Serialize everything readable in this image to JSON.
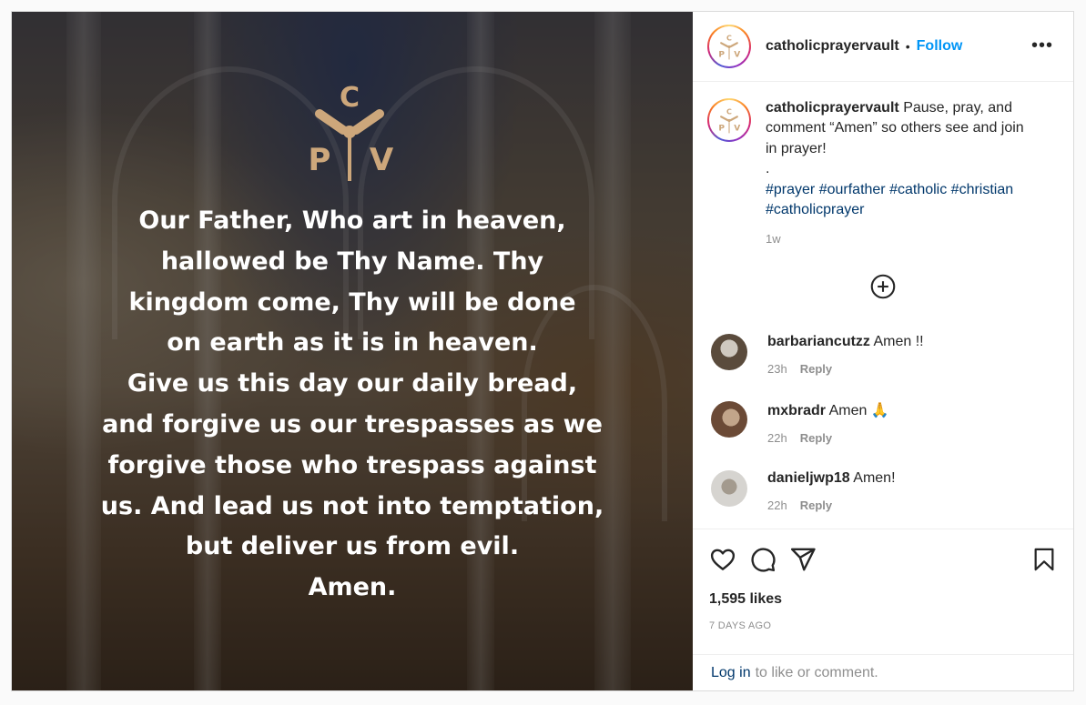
{
  "post": {
    "username": "catholicprayervault",
    "follow_label": "Follow",
    "more_label": "•••",
    "logo_letters": [
      "C",
      "P",
      "V"
    ],
    "image_text": [
      "Our Father, Who art in heaven,",
      "hallowed be Thy Name. Thy",
      "kingdom come, Thy will be done",
      "on earth as it is in heaven.",
      "Give us this day our daily bread,",
      "and forgive us our trespasses as we",
      "forgive those who trespass against",
      "us. And lead us not into temptation,",
      "but deliver us from evil.",
      "Amen."
    ]
  },
  "caption": {
    "username": "catholicprayervault",
    "text": "Pause, pray, and comment “Amen” so others see and join in prayer!",
    "separator": ".",
    "hashtags": "#prayer #ourfather #catholic #christian #catholicprayer",
    "time": "1w"
  },
  "comments": [
    {
      "username": "barbariancutzz",
      "text": "Amen !!",
      "time": "23h",
      "reply": "Reply"
    },
    {
      "username": "mxbradr",
      "text": "Amen 🙏",
      "time": "22h",
      "reply": "Reply"
    },
    {
      "username": "danieljwp18",
      "text": "Amen!",
      "time": "22h",
      "reply": "Reply"
    }
  ],
  "actions": {
    "likes": "1,595 likes",
    "posted": "7 DAYS AGO"
  },
  "login": {
    "link": "Log in",
    "rest": "to like or comment."
  },
  "colors": {
    "accent": "#0095f6",
    "hashtag": "#00376b",
    "logo_gold": "#cda77b",
    "muted": "#8e8e8e"
  },
  "icons": [
    "more-icon",
    "add-comment-icon",
    "heart-icon",
    "comment-icon",
    "share-icon",
    "bookmark-icon"
  ]
}
